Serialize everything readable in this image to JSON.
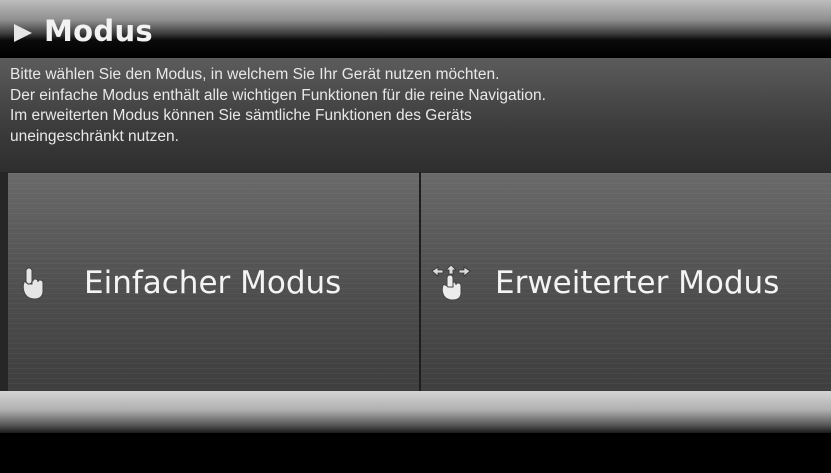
{
  "header": {
    "title": "Modus",
    "icon": "play-arrow-icon"
  },
  "description": {
    "line1": "Bitte wählen Sie den Modus, in welchem Sie Ihr Gerät nutzen möchten.",
    "line2": "Der einfache Modus enthält alle wichtigen Funktionen für die reine Navigation.",
    "line3": "Im erweiterten Modus können Sie sämtliche Funktionen des Geräts",
    "line4": "uneingeschränkt nutzen."
  },
  "options": {
    "simple": {
      "label": "Einfacher Modus",
      "icon": "pointing-hand-icon"
    },
    "advanced": {
      "label": "Erweiterter Modus",
      "icon": "hand-arrows-icon"
    }
  }
}
